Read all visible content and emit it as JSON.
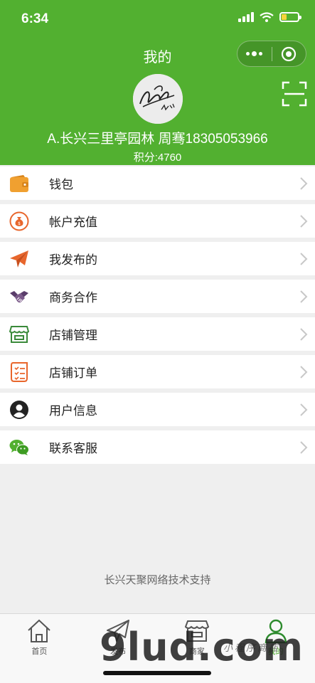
{
  "status": {
    "time": "6:34"
  },
  "header": {
    "title": "我的",
    "user_name": "A.长兴三里亭园林 周骞18305053966",
    "points_label": "积分:4760"
  },
  "menu": [
    {
      "label": "钱包",
      "icon": "wallet-icon",
      "color": "#f0a030"
    },
    {
      "label": "帐户充值",
      "icon": "money-bag-icon",
      "color": "#e8662c"
    },
    {
      "label": "我发布的",
      "icon": "paper-plane-icon",
      "color": "#e8662c"
    },
    {
      "label": "商务合作",
      "icon": "handshake-icon",
      "color": "#5a3d6a"
    },
    {
      "label": "店铺管理",
      "icon": "store-icon",
      "color": "#3a8a3a"
    },
    {
      "label": "店铺订单",
      "icon": "order-list-icon",
      "color": "#e8662c"
    },
    {
      "label": "用户信息",
      "icon": "user-icon",
      "color": "#222222"
    },
    {
      "label": "联系客服",
      "icon": "wechat-icon",
      "color": "#52b030"
    }
  ],
  "footer": {
    "support_text": "长兴天聚网络技术支持"
  },
  "tabbar": [
    {
      "label": "首页",
      "icon": "home-icon"
    },
    {
      "label": "发布",
      "icon": "send-icon"
    },
    {
      "label": "商家",
      "icon": "shop-icon"
    },
    {
      "label": "我的",
      "icon": "profile-icon",
      "active": true
    }
  ],
  "watermark": {
    "text": "9lud.com",
    "sub": "小程序商店"
  },
  "colors": {
    "brand": "#52b030",
    "accent": "#e8662c"
  }
}
